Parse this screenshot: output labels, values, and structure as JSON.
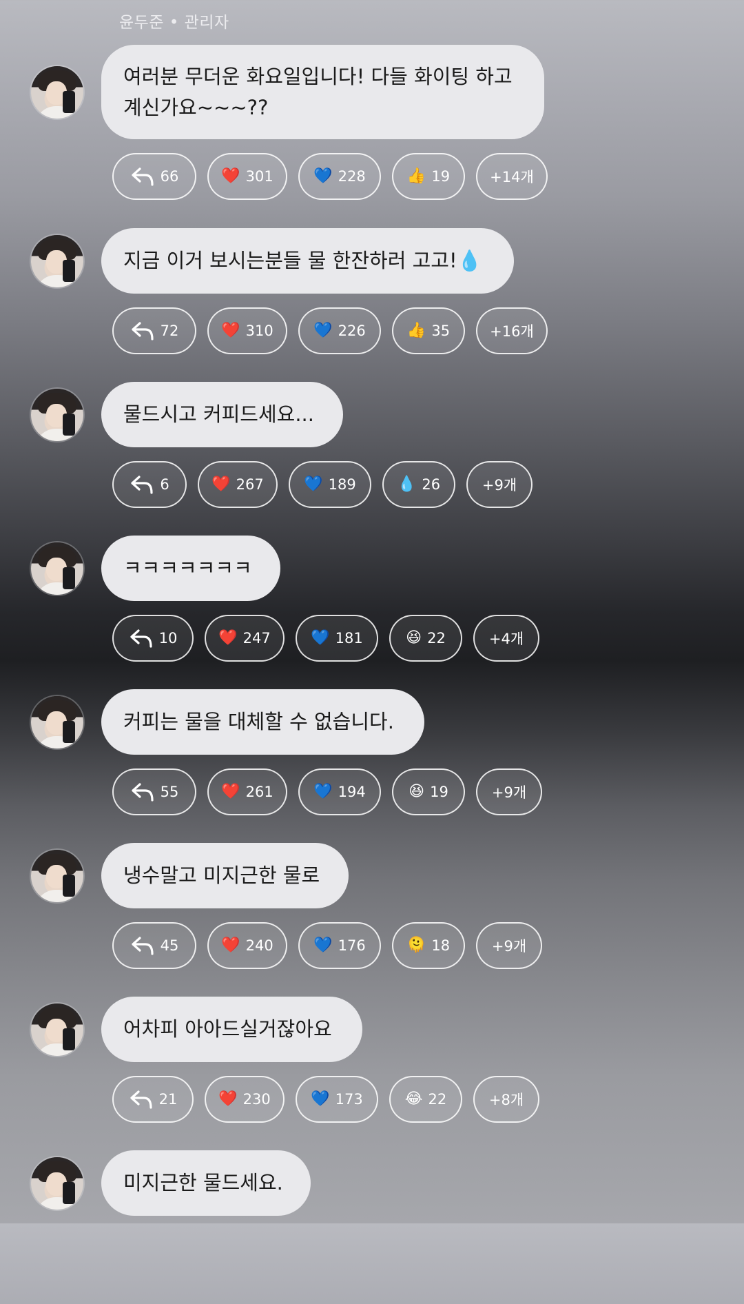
{
  "sender_line": "윤두준 • 관리자",
  "messages": [
    {
      "text": "여러분 무더운 화요일입니다! 다들 화이팅 하고\n계신가요~~~??",
      "reply": "66",
      "reactions": [
        {
          "emoji": "❤️",
          "icon": "heart",
          "count": "301"
        },
        {
          "emoji": "💙",
          "icon": "blue-heart",
          "count": "228"
        },
        {
          "emoji": "👍",
          "icon": "thumbs-up",
          "count": "19"
        }
      ],
      "more": "+14개"
    },
    {
      "text": "지금 이거 보시는분들 물 한잔하러 고고!💧",
      "reply": "72",
      "reactions": [
        {
          "emoji": "❤️",
          "icon": "heart",
          "count": "310"
        },
        {
          "emoji": "💙",
          "icon": "blue-heart",
          "count": "226"
        },
        {
          "emoji": "👍",
          "icon": "thumbs-up",
          "count": "35"
        }
      ],
      "more": "+16개"
    },
    {
      "text": "물드시고 커피드세요...",
      "reply": "6",
      "reactions": [
        {
          "emoji": "❤️",
          "icon": "heart",
          "count": "267"
        },
        {
          "emoji": "💙",
          "icon": "blue-heart",
          "count": "189"
        },
        {
          "emoji": "💧",
          "icon": "droplet",
          "count": "26"
        }
      ],
      "more": "+9개"
    },
    {
      "text": "ㅋㅋㅋㅋㅋㅋㅋ",
      "reply": "10",
      "reactions": [
        {
          "emoji": "❤️",
          "icon": "heart",
          "count": "247"
        },
        {
          "emoji": "💙",
          "icon": "blue-heart",
          "count": "181"
        },
        {
          "emoji": "😆",
          "icon": "grinning-squint",
          "count": "22"
        }
      ],
      "more": "+4개"
    },
    {
      "text": "커피는 물을 대체할 수 없습니다.",
      "reply": "55",
      "reactions": [
        {
          "emoji": "❤️",
          "icon": "heart",
          "count": "261"
        },
        {
          "emoji": "💙",
          "icon": "blue-heart",
          "count": "194"
        },
        {
          "emoji": "😆",
          "icon": "grinning-squint",
          "count": "19"
        }
      ],
      "more": "+9개"
    },
    {
      "text": "냉수말고 미지근한 물로",
      "reply": "45",
      "reactions": [
        {
          "emoji": "❤️",
          "icon": "heart",
          "count": "240"
        },
        {
          "emoji": "💙",
          "icon": "blue-heart",
          "count": "176"
        },
        {
          "emoji": "🫠",
          "icon": "hugging-face",
          "count": "18"
        }
      ],
      "more": "+9개"
    },
    {
      "text": "어차피 아아드실거잖아요",
      "reply": "21",
      "reactions": [
        {
          "emoji": "❤️",
          "icon": "heart",
          "count": "230"
        },
        {
          "emoji": "💙",
          "icon": "blue-heart",
          "count": "173"
        },
        {
          "emoji": "😂",
          "icon": "tears-of-joy",
          "count": "22"
        }
      ],
      "more": "+8개"
    },
    {
      "text": "미지근한 물드세요.",
      "reply": null,
      "reactions": [],
      "more": null
    }
  ]
}
